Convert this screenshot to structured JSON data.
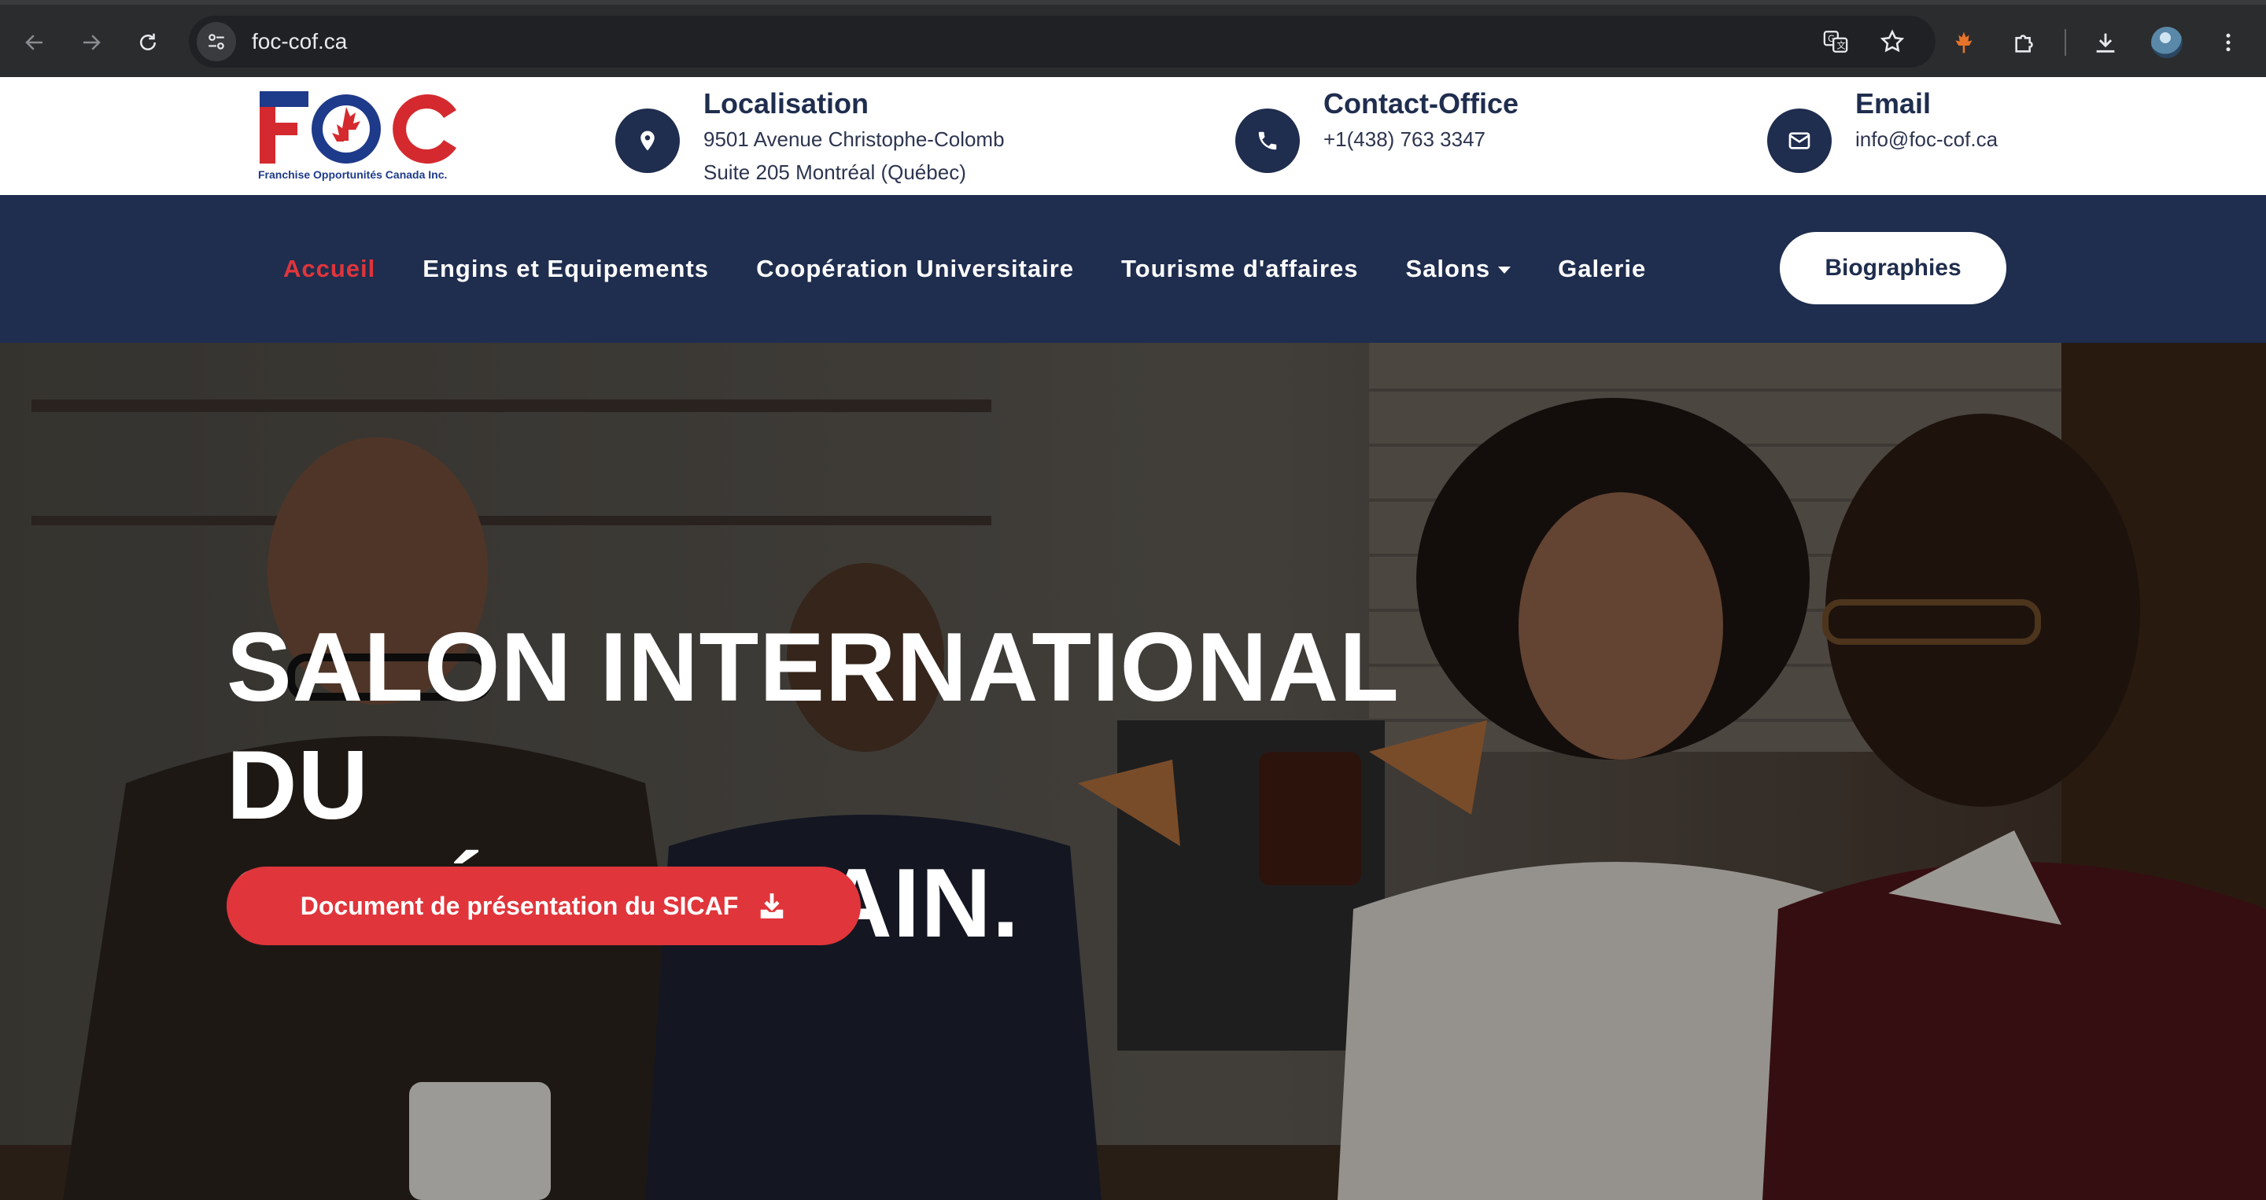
{
  "browser": {
    "url": "foc-cof.ca"
  },
  "header": {
    "logo_text": "FOC",
    "logo_tagline": "Franchise Opportunités Canada Inc.",
    "location": {
      "title": "Localisation",
      "line1": "9501 Avenue Christophe-Colomb",
      "line2": "Suite 205 Montréal (Québec)"
    },
    "contact": {
      "title": "Contact-Office",
      "phone": "+1(438) 763 3347"
    },
    "email": {
      "title": "Email",
      "address": "info@foc-cof.ca"
    }
  },
  "nav": {
    "items": [
      {
        "label": "Accueil"
      },
      {
        "label": "Engins et Equipements"
      },
      {
        "label": "Coopération Universitaire"
      },
      {
        "label": "Tourisme d'affaires"
      },
      {
        "label": "Salons"
      },
      {
        "label": "Galerie"
      }
    ],
    "button": "Biographies"
  },
  "hero": {
    "title_line1": "SALON INTERNATIONAL DU",
    "title_line2": "CAFÉ AFRICAIN.",
    "cta": "Document de présentation du SICAF"
  },
  "colors": {
    "navy": "#1f2d4e",
    "accent_red": "#e0353b"
  }
}
